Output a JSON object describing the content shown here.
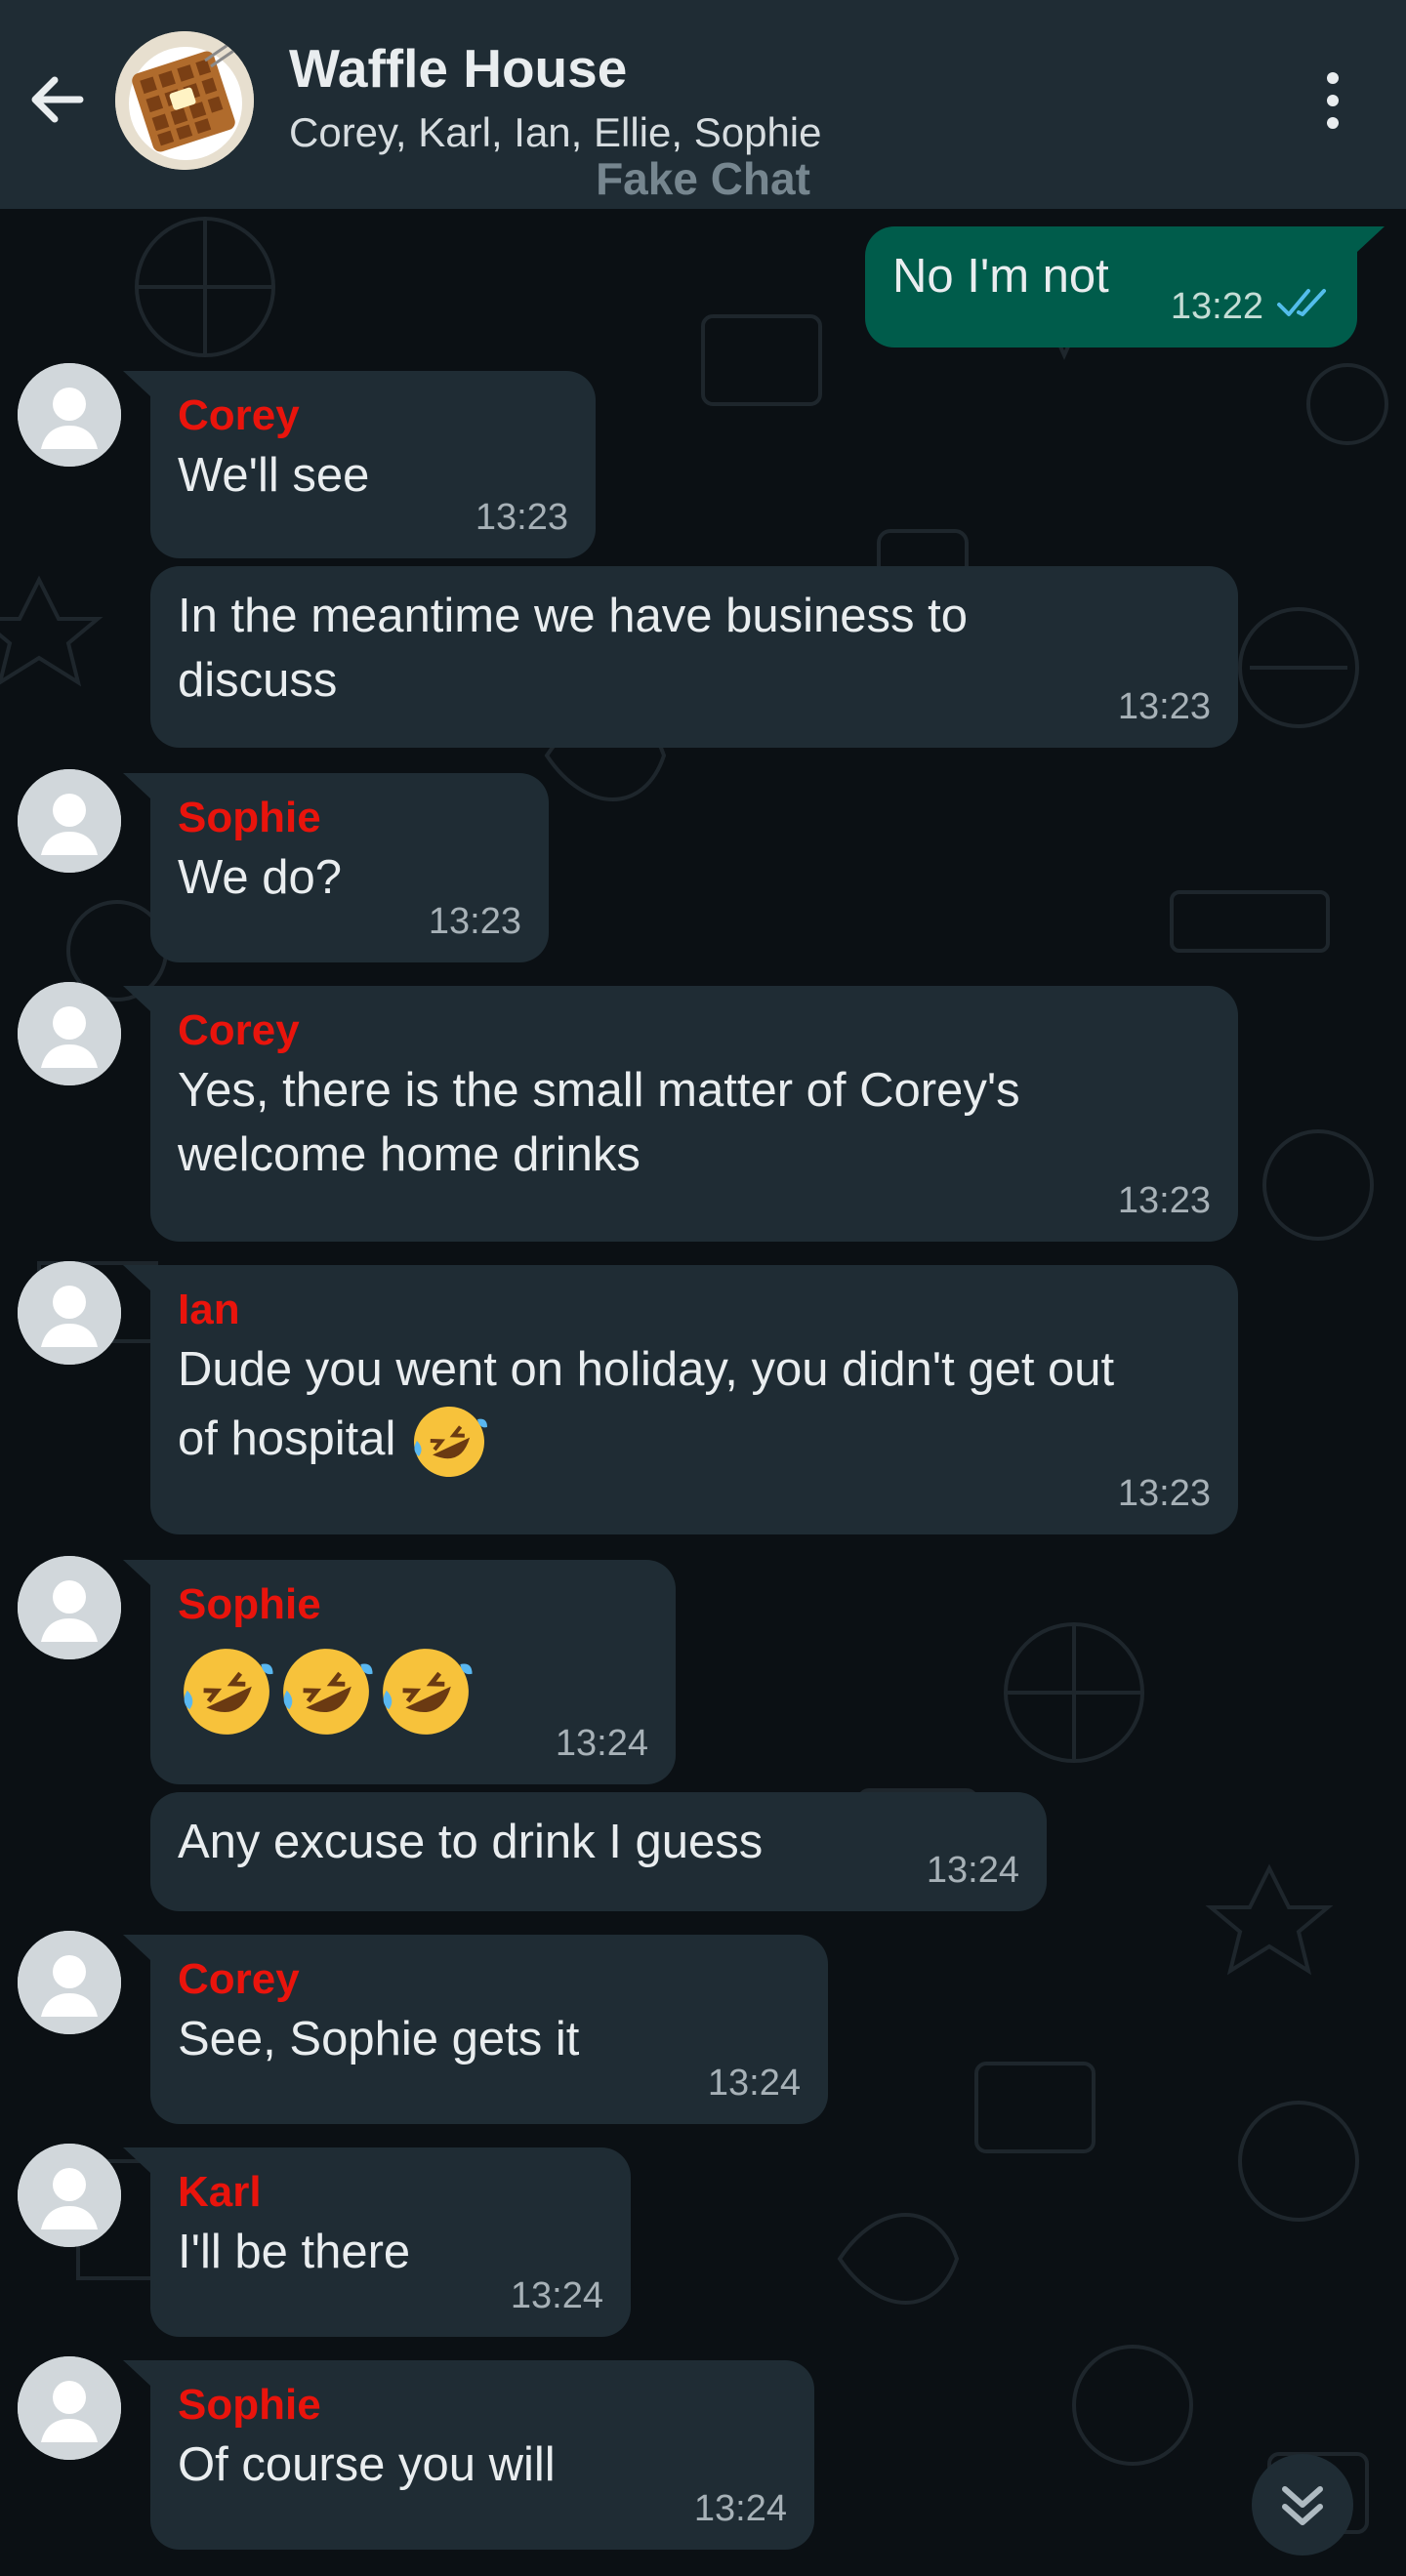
{
  "header": {
    "title": "Waffle House",
    "members": "Corey, Karl, Ian, Ellie, Sophie",
    "watermark": "Fake Chat"
  },
  "colors": {
    "header_bg": "#1f2c34",
    "chat_bg": "#0b1014",
    "incoming_bubble": "#1f2c34",
    "outgoing_bubble": "#005c4b",
    "sender_name": "#e9140c",
    "read_ticks": "#53bdeb"
  },
  "icons": {
    "back": "arrow-left-icon",
    "menu": "more-vertical-icon",
    "read": "double-check-icon",
    "emoji": "rolling-on-floor-laughing-emoji",
    "scroll": "double-chevron-down-icon"
  },
  "messages": [
    {
      "direction": "out",
      "text": "No I'm not",
      "time": "13:22",
      "status": "read"
    },
    {
      "direction": "in",
      "sender": "Corey",
      "text": "We'll see",
      "time": "13:23"
    },
    {
      "direction": "in",
      "text": "In the meantime we have business to discuss",
      "time": "13:23"
    },
    {
      "direction": "in",
      "sender": "Sophie",
      "text": "We do?",
      "time": "13:23"
    },
    {
      "direction": "in",
      "sender": "Corey",
      "text": "Yes, there is the small matter of Corey's welcome home drinks",
      "time": "13:23"
    },
    {
      "direction": "in",
      "sender": "Ian",
      "text": "Dude you went on holiday, you didn't get out of hospital",
      "emoji_count": 1,
      "time": "13:23"
    },
    {
      "direction": "in",
      "sender": "Sophie",
      "text": "",
      "emoji_count": 3,
      "time": "13:24"
    },
    {
      "direction": "in",
      "text": "Any excuse to drink I guess",
      "time": "13:24"
    },
    {
      "direction": "in",
      "sender": "Corey",
      "text": "See, Sophie gets it",
      "time": "13:24"
    },
    {
      "direction": "in",
      "sender": "Karl",
      "text": "I'll be there",
      "time": "13:24"
    },
    {
      "direction": "in",
      "sender": "Sophie",
      "text": "Of course you will",
      "time": "13:24"
    }
  ]
}
